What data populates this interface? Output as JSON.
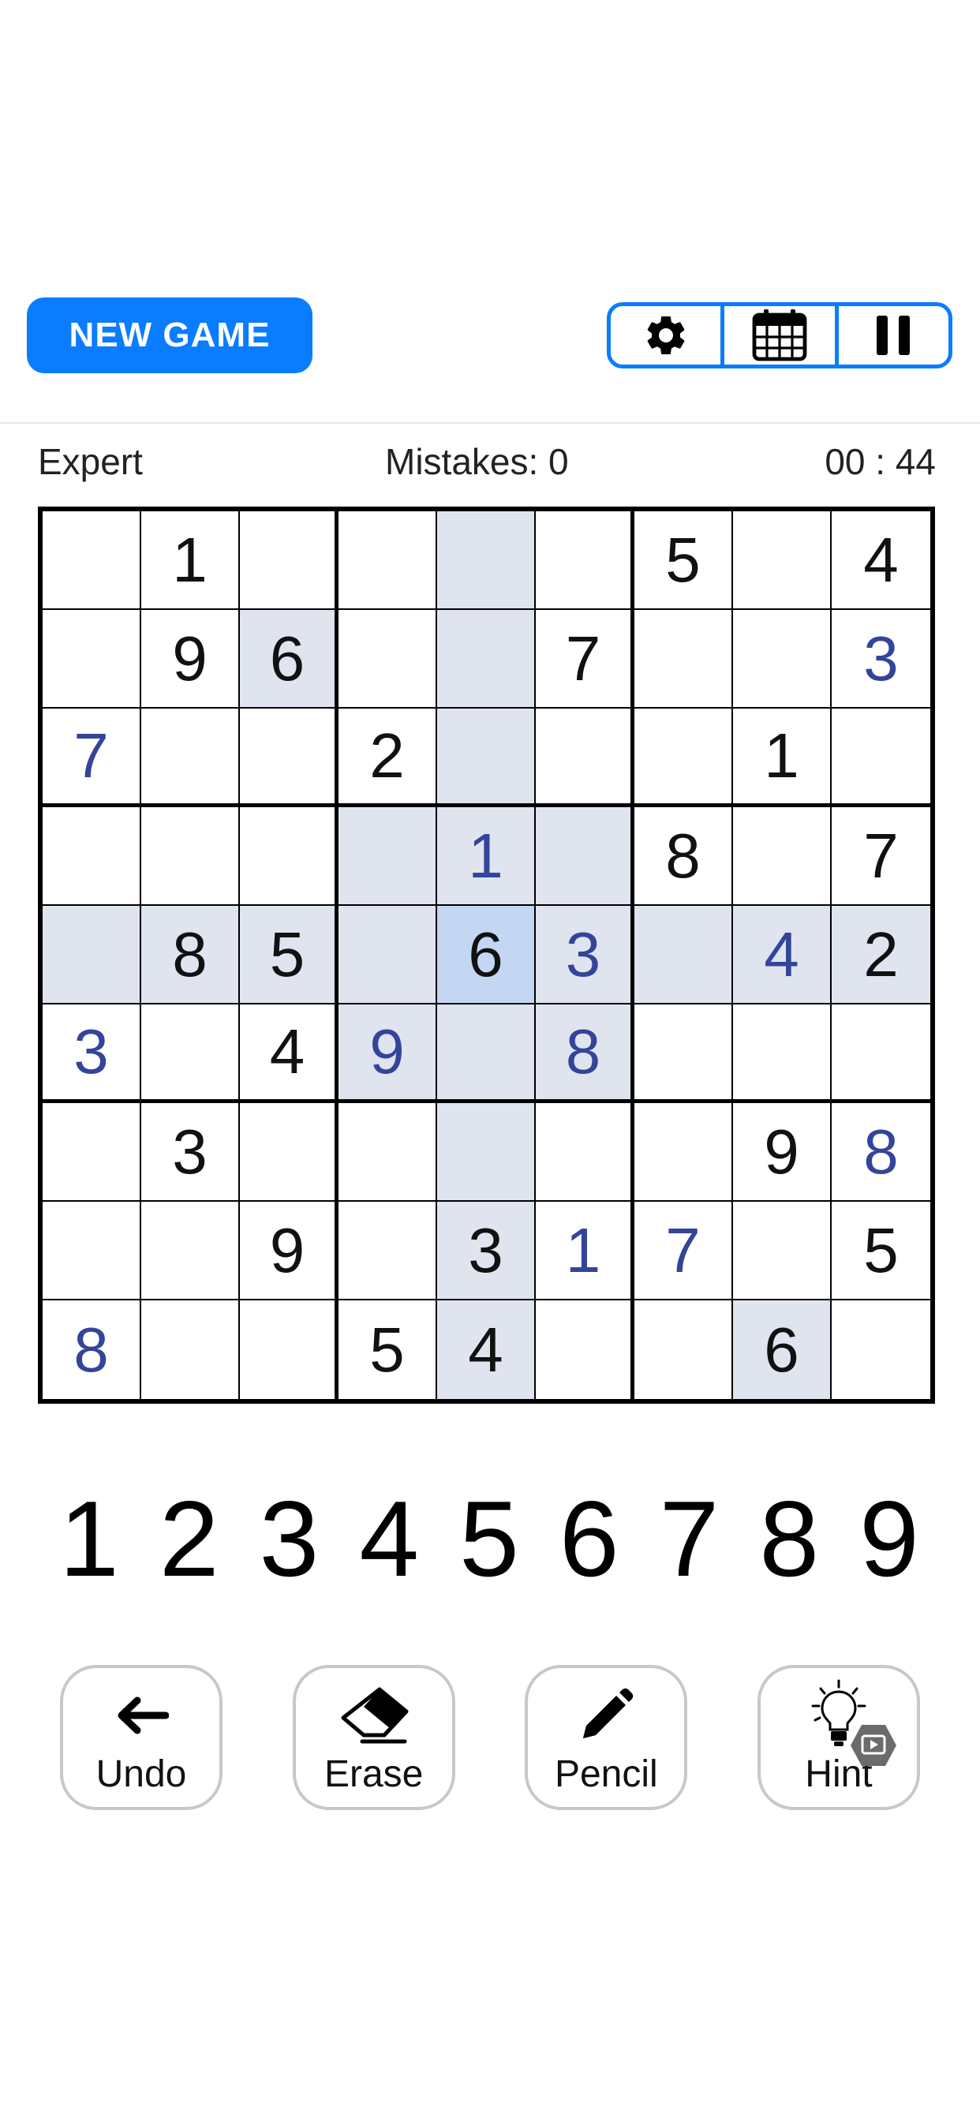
{
  "header": {
    "new_game_label": "NEW GAME",
    "toolbar": {
      "settings_icon": "gear-icon",
      "calendar_icon": "calendar-icon",
      "pause_icon": "pause-icon"
    }
  },
  "status": {
    "level": "Expert",
    "mistakes": "Mistakes: 0",
    "timer": "00 : 44"
  },
  "board": {
    "rows": [
      [
        "",
        "1",
        "",
        "",
        "",
        "",
        "5",
        "",
        "4"
      ],
      [
        "",
        "9",
        "6",
        "",
        "",
        "7",
        "",
        "",
        "3"
      ],
      [
        "7",
        "",
        "",
        "2",
        "",
        "",
        "",
        "1",
        ""
      ],
      [
        "",
        "",
        "",
        "",
        "1",
        "",
        "8",
        "",
        "7"
      ],
      [
        "",
        "8",
        "5",
        "",
        "6",
        "3",
        "",
        "4",
        "2"
      ],
      [
        "3",
        "",
        "4",
        "9",
        "",
        "8",
        "",
        "",
        ""
      ],
      [
        "",
        "3",
        "",
        "",
        "",
        "",
        "",
        "9",
        "8"
      ],
      [
        "",
        "",
        "9",
        "",
        "3",
        "1",
        "7",
        "",
        "5"
      ],
      [
        "8",
        "",
        "",
        "5",
        "4",
        "",
        "",
        "6",
        ""
      ]
    ],
    "user_entered": [
      [
        1,
        8
      ],
      [
        2,
        0
      ],
      [
        3,
        4
      ],
      [
        4,
        5
      ],
      [
        4,
        7
      ],
      [
        5,
        0
      ],
      [
        5,
        3
      ],
      [
        5,
        5
      ],
      [
        6,
        8
      ],
      [
        7,
        5
      ],
      [
        7,
        6
      ],
      [
        8,
        0
      ]
    ],
    "selected": [
      4,
      4
    ],
    "highlight_color": "#dfe4ee",
    "selected_color": "#c3d6f2",
    "user_digit_color": "#34449a"
  },
  "numpad": [
    "1",
    "2",
    "3",
    "4",
    "5",
    "6",
    "7",
    "8",
    "9"
  ],
  "actions": {
    "undo": "Undo",
    "erase": "Erase",
    "pencil": "Pencil",
    "hint": "Hint"
  },
  "colors": {
    "accent": "#0a7cff"
  }
}
